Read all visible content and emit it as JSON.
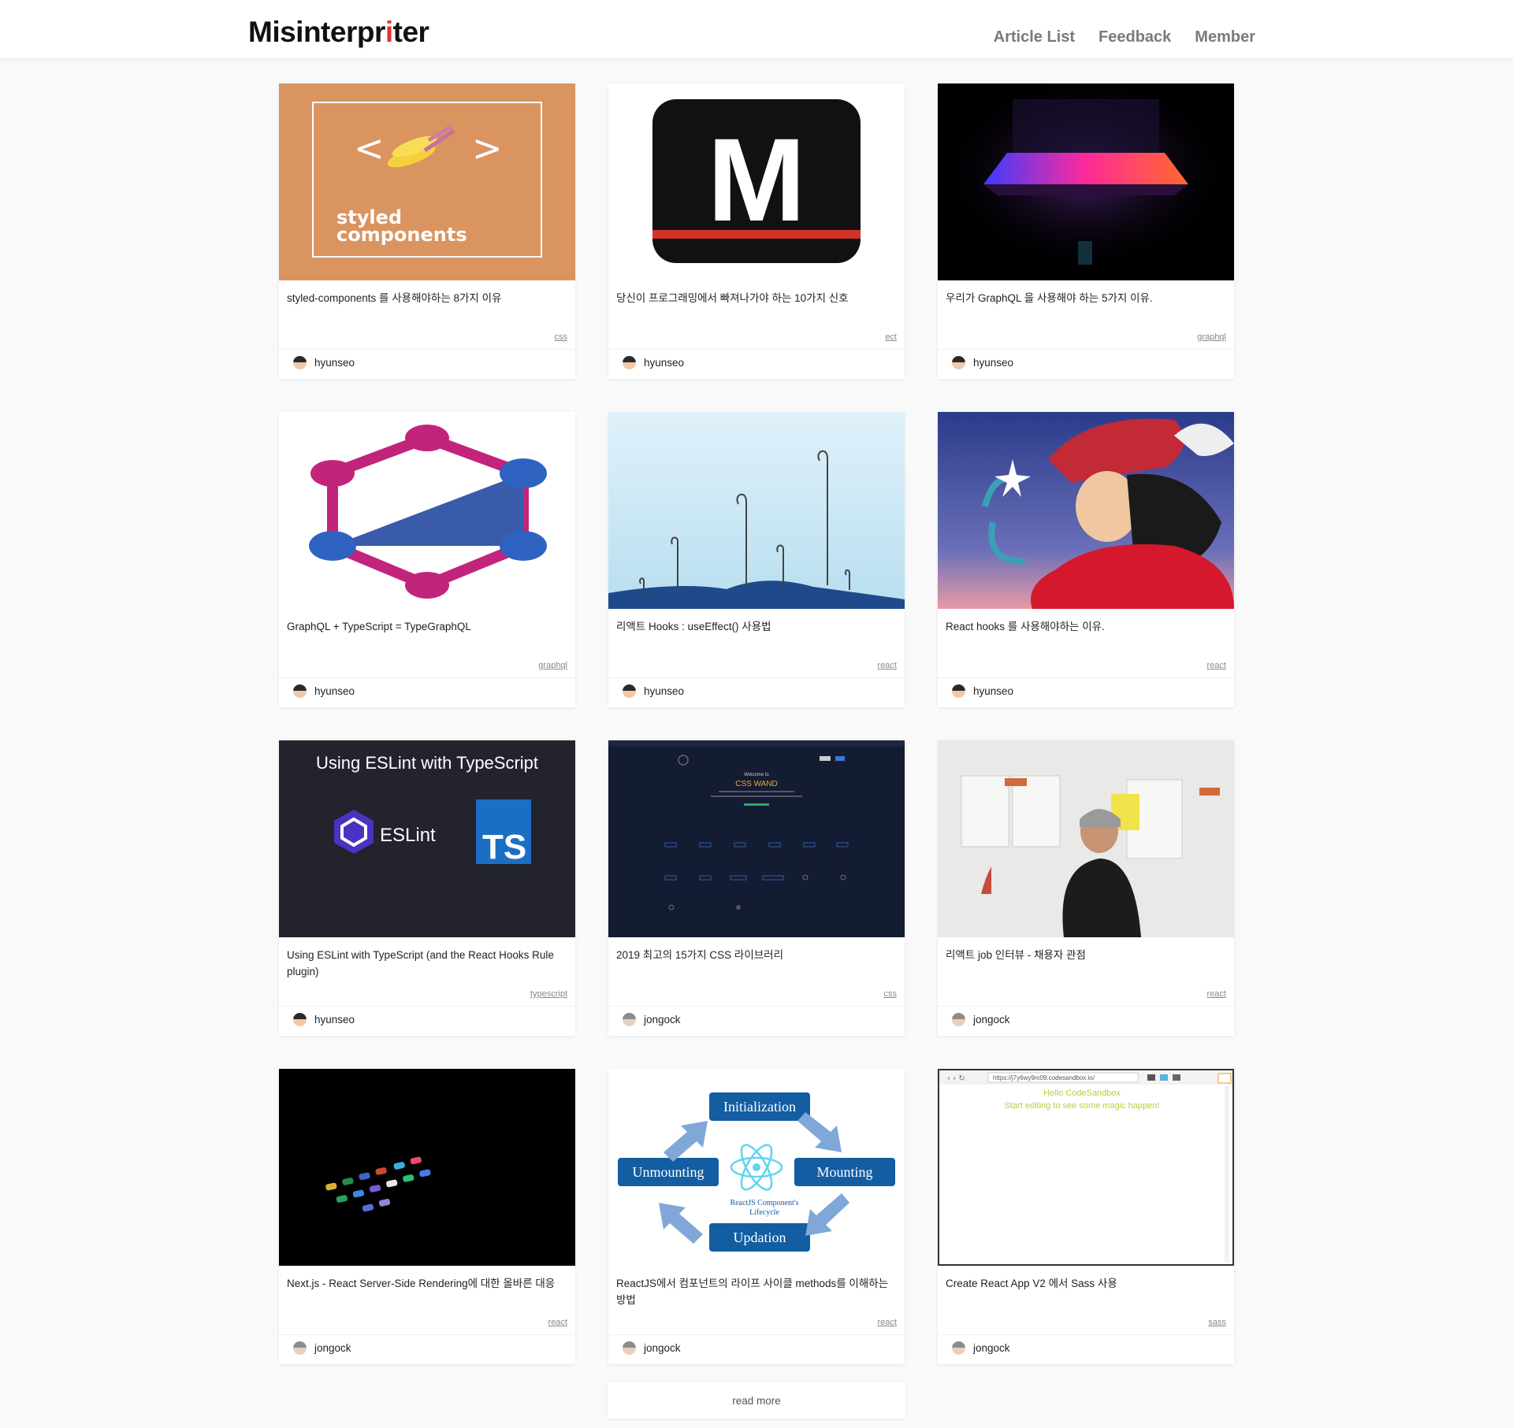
{
  "header": {
    "logo_pre": "Misinterpr",
    "logo_accent": "i",
    "logo_post": "ter",
    "nav": [
      "Article List",
      "Feedback",
      "Member"
    ]
  },
  "articles": [
    {
      "title": "styled-components 를 사용해야하는 8가지 이유",
      "tag": "css",
      "author": "hyunseo",
      "thumb": "styled"
    },
    {
      "title": "당신이 프로그래밍에서 빠져나가야 하는 10가지 신호",
      "tag": "ect",
      "author": "hyunseo",
      "thumb": "medium"
    },
    {
      "title": "우리가 GraphQL 을 사용해야 하는 5가지 이유.",
      "tag": "graphql",
      "author": "hyunseo",
      "thumb": "laptop"
    },
    {
      "title": "GraphQL + TypeScript = TypeGraphQL",
      "tag": "graphql",
      "author": "hyunseo",
      "thumb": "typegraphql"
    },
    {
      "title": "리액트 Hooks : useEffect() 사용법",
      "tag": "react",
      "author": "hyunseo",
      "thumb": "hooks"
    },
    {
      "title": "React hooks 를 사용해야하는 이유.",
      "tag": "react",
      "author": "hyunseo",
      "thumb": "captain"
    },
    {
      "title": "Using ESLint with TypeScript (and the React Hooks Rule plugin)",
      "tag": "typescript",
      "author": "hyunseo",
      "thumb": "eslint"
    },
    {
      "title": "2019 최고의 15가지 CSS 라이브러리",
      "tag": "css",
      "author": "jongock",
      "thumb": "csswand"
    },
    {
      "title": "리액트 job 인터뷰 - 채용자 관점",
      "tag": "react",
      "author": "jongock",
      "thumb": "interview"
    },
    {
      "title": "Next.js - React Server-Side Rendering에 대한 올바른 대응",
      "tag": "react",
      "author": "jongock",
      "thumb": "phone"
    },
    {
      "title": "ReactJS에서 컴포넌트의 라이프 사이클 methods를 이해하는 방법",
      "tag": "react",
      "author": "jongock",
      "thumb": "lifecycle"
    },
    {
      "title": "Create React App V2 에서 Sass 사용",
      "tag": "sass",
      "author": "jongock",
      "thumb": "sandbox"
    }
  ],
  "thumb_text": {
    "styled": [
      "<",
      ">",
      "styled",
      "components"
    ],
    "medium": "M",
    "eslint": [
      "Using ESLint with  TypeScript",
      "ESLint",
      "TS"
    ],
    "csswand": [
      "Welcome to",
      "CSS WAND"
    ],
    "lifecycle": [
      "Initialization",
      "Mounting",
      "Updation",
      "Unmounting",
      "ReactJS Component's",
      "Lifecycle"
    ],
    "sandbox": [
      "https://j7y6wy9m09.codesandbox.io/",
      "Hello CodeSandbox",
      "Start editing to see some magic happen!"
    ]
  },
  "read_more": "read more",
  "colors": {
    "accent": "#e8322b",
    "nav": "#7a7a7a",
    "tag": "#888888"
  }
}
